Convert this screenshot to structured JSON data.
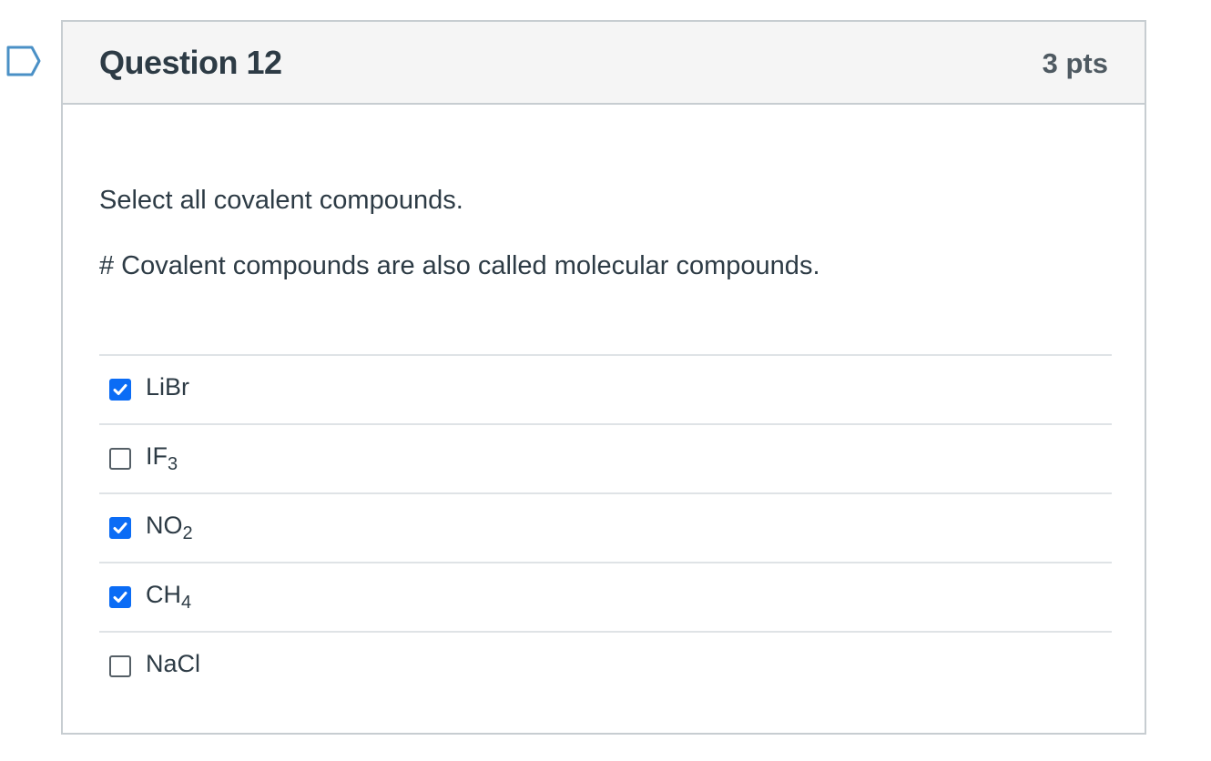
{
  "question": {
    "title": "Question 12",
    "points": "3 pts",
    "prompt": "Select all covalent compounds.",
    "note": "# Covalent compounds are also called molecular compounds."
  },
  "answers": [
    {
      "base": "LiBr",
      "sub": "",
      "checked": true
    },
    {
      "base": "IF",
      "sub": "3",
      "checked": false
    },
    {
      "base": "NO",
      "sub": "2",
      "checked": true
    },
    {
      "base": "CH",
      "sub": "4",
      "checked": true
    },
    {
      "base": "NaCl",
      "sub": "",
      "checked": false
    }
  ],
  "colors": {
    "checkbox_checked": "#0b6cf5",
    "header_bg": "#f5f5f5",
    "text": "#2d3b45"
  },
  "icons": {
    "flag": "bookmark-flag-icon",
    "check": "checkmark-icon"
  }
}
